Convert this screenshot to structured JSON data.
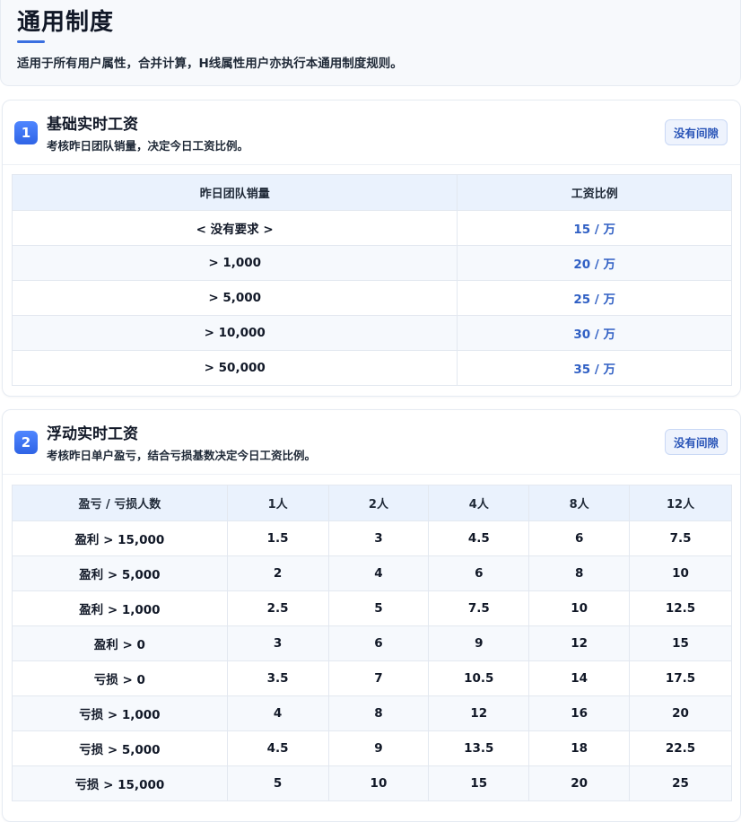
{
  "page": {
    "title": "通用制度",
    "description": "适用于所有用户属性，合并计算，H线属性用户亦执行本通用制度规则。"
  },
  "sections": [
    {
      "number": "1",
      "title": "基础实时工资",
      "subtitle": "考核昨日团队销量，决定今日工资比例。",
      "tag": "没有间隙",
      "table": {
        "headers": [
          "昨日团队销量",
          "工资比例"
        ],
        "rows": [
          [
            "< 没有要求 >",
            "15 / 万"
          ],
          [
            "> 1,000",
            "20 / 万"
          ],
          [
            "> 5,000",
            "25 / 万"
          ],
          [
            "> 10,000",
            "30 / 万"
          ],
          [
            "> 50,000",
            "35 / 万"
          ]
        ]
      }
    },
    {
      "number": "2",
      "title": "浮动实时工资",
      "subtitle": "考核昨日单户盈亏，结合亏损基数决定今日工资比例。",
      "tag": "没有间隙",
      "table": {
        "headers": [
          "盈亏 / 亏损人数",
          "1人",
          "2人",
          "4人",
          "8人",
          "12人"
        ],
        "rows": [
          [
            "盈利 > 15,000",
            "1.5",
            "3",
            "4.5",
            "6",
            "7.5"
          ],
          [
            "盈利 > 5,000",
            "2",
            "4",
            "6",
            "8",
            "10"
          ],
          [
            "盈利 > 1,000",
            "2.5",
            "5",
            "7.5",
            "10",
            "12.5"
          ],
          [
            "盈利 > 0",
            "3",
            "6",
            "9",
            "12",
            "15"
          ],
          [
            "亏损 > 0",
            "3.5",
            "7",
            "10.5",
            "14",
            "17.5"
          ],
          [
            "亏损 > 1,000",
            "4",
            "8",
            "12",
            "16",
            "20"
          ],
          [
            "亏损 > 5,000",
            "4.5",
            "9",
            "13.5",
            "18",
            "22.5"
          ],
          [
            "亏损 > 15,000",
            "5",
            "10",
            "15",
            "20",
            "25"
          ]
        ]
      }
    }
  ],
  "colors": {
    "accent": "#3b6fe0",
    "rate_text": "#2f5fc4",
    "header_bg": "#eaf2fd"
  }
}
